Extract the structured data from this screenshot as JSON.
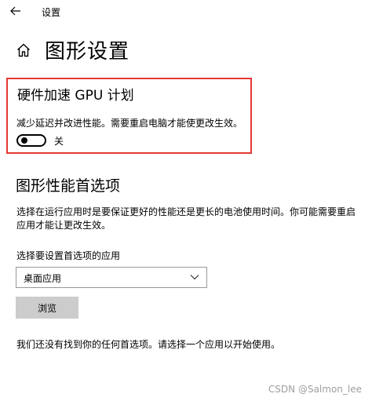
{
  "titlebar": {
    "back_icon": "arrow-left-icon",
    "app_title": "设置"
  },
  "header": {
    "home_icon": "home-icon",
    "title": "图形设置"
  },
  "gpu_scheduling": {
    "heading": "硬件加速 GPU 计划",
    "description": "减少延迟并改进性能。需要重启电脑才能使更改生效。",
    "toggle_state": "off",
    "toggle_label": "关",
    "highlight_color": "#e53935"
  },
  "graphics_preference": {
    "heading": "图形性能首选项",
    "description": "选择在运行应用时是要保证更好的性能还是更长的电池使用时间。你可能需要重启应用才能让更改生效。",
    "select_label": "选择要设置首选项的应用",
    "select_value": "桌面应用",
    "browse_label": "浏览",
    "empty_note": "我们还没有找到你的任何首选项。请选择一个应用以开始使用。"
  },
  "watermark": "CSDN @Salmon_lee"
}
